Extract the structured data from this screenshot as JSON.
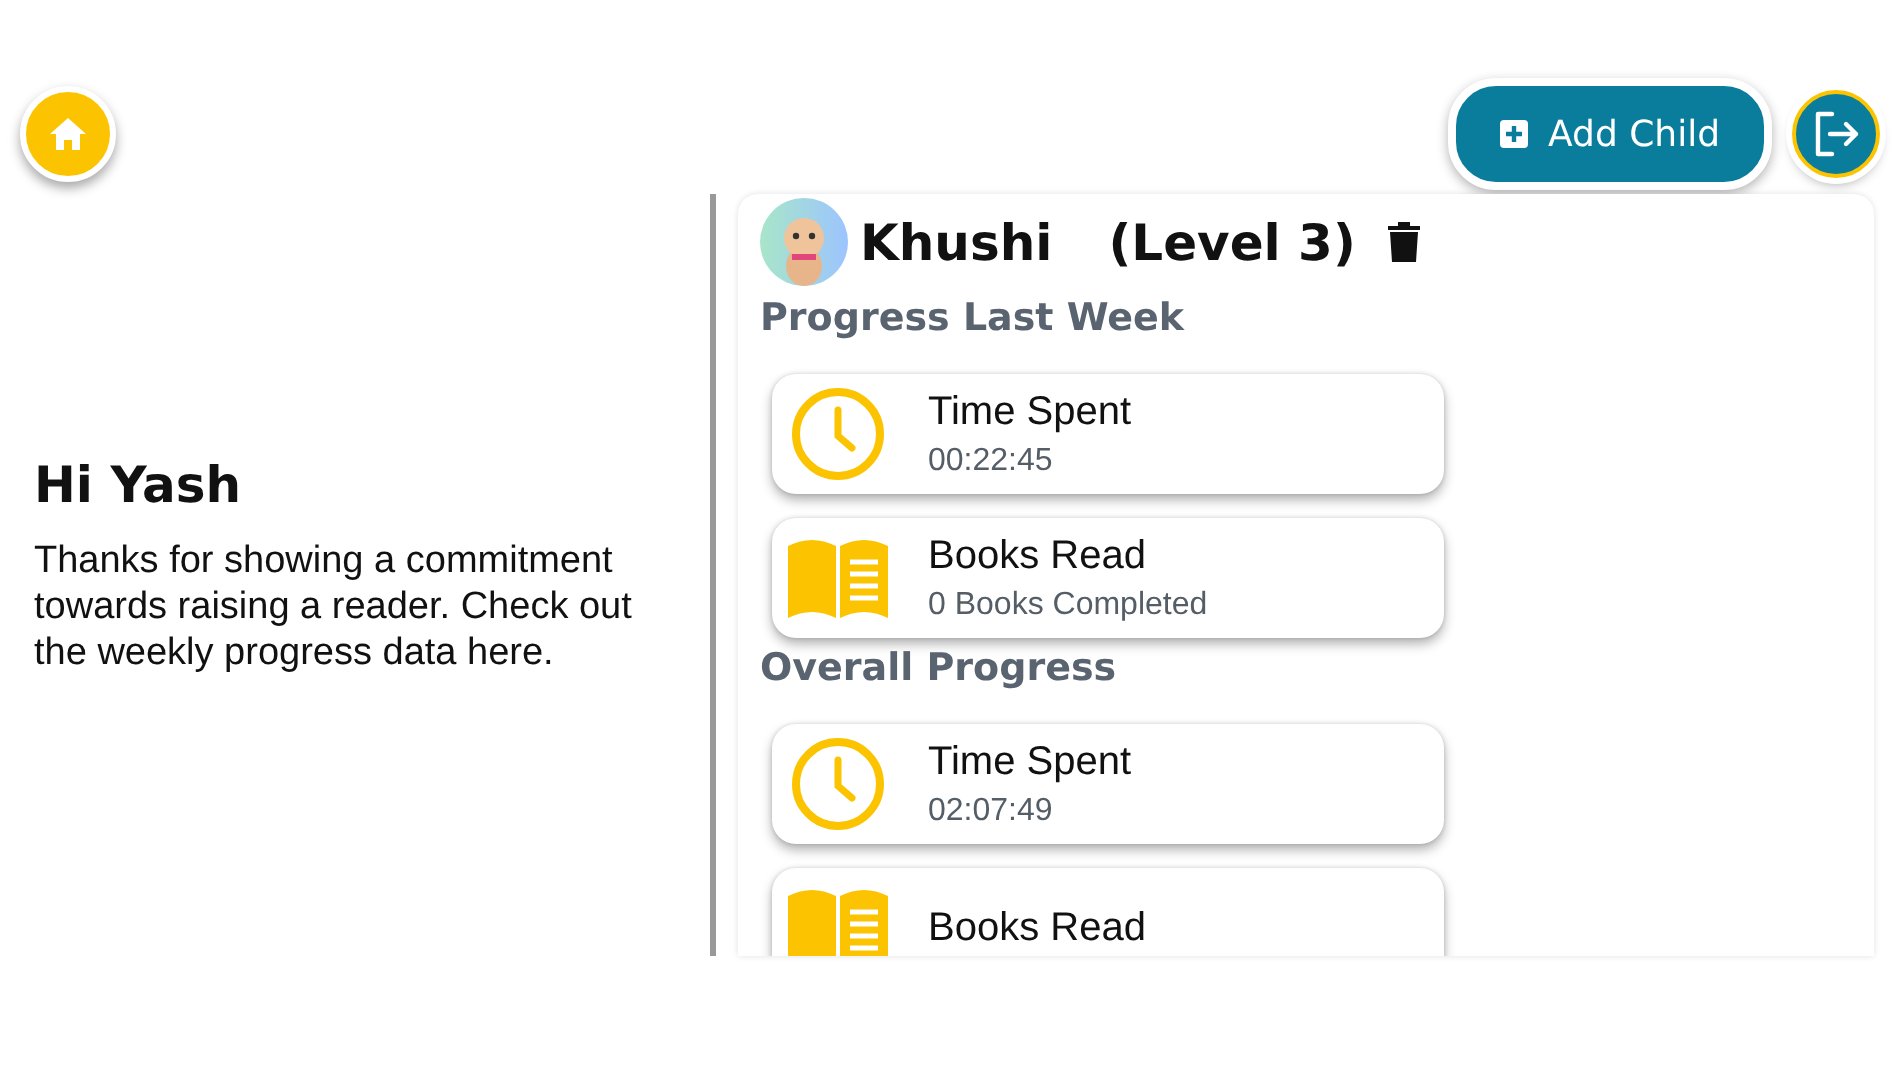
{
  "header": {
    "add_button": {
      "label": "Add Child"
    }
  },
  "greeting": {
    "title": "Hi Yash",
    "message": "Thanks for showing a commitment towards raising a reader. Check out the weekly progress data here."
  },
  "child": {
    "name": "Khushi",
    "level": "(Level 3)"
  },
  "sections": [
    {
      "title": "Progress Last Week",
      "cards": [
        {
          "kind": "time",
          "title": "Time Spent",
          "value": "00:22:45"
        },
        {
          "kind": "books",
          "title": "Books Read",
          "value": "0 Books Completed"
        }
      ]
    },
    {
      "title": "Overall Progress",
      "cards": [
        {
          "kind": "time",
          "title": "Time Spent",
          "value": "02:07:49"
        },
        {
          "kind": "books",
          "title": "Books Read"
        }
      ]
    }
  ]
}
